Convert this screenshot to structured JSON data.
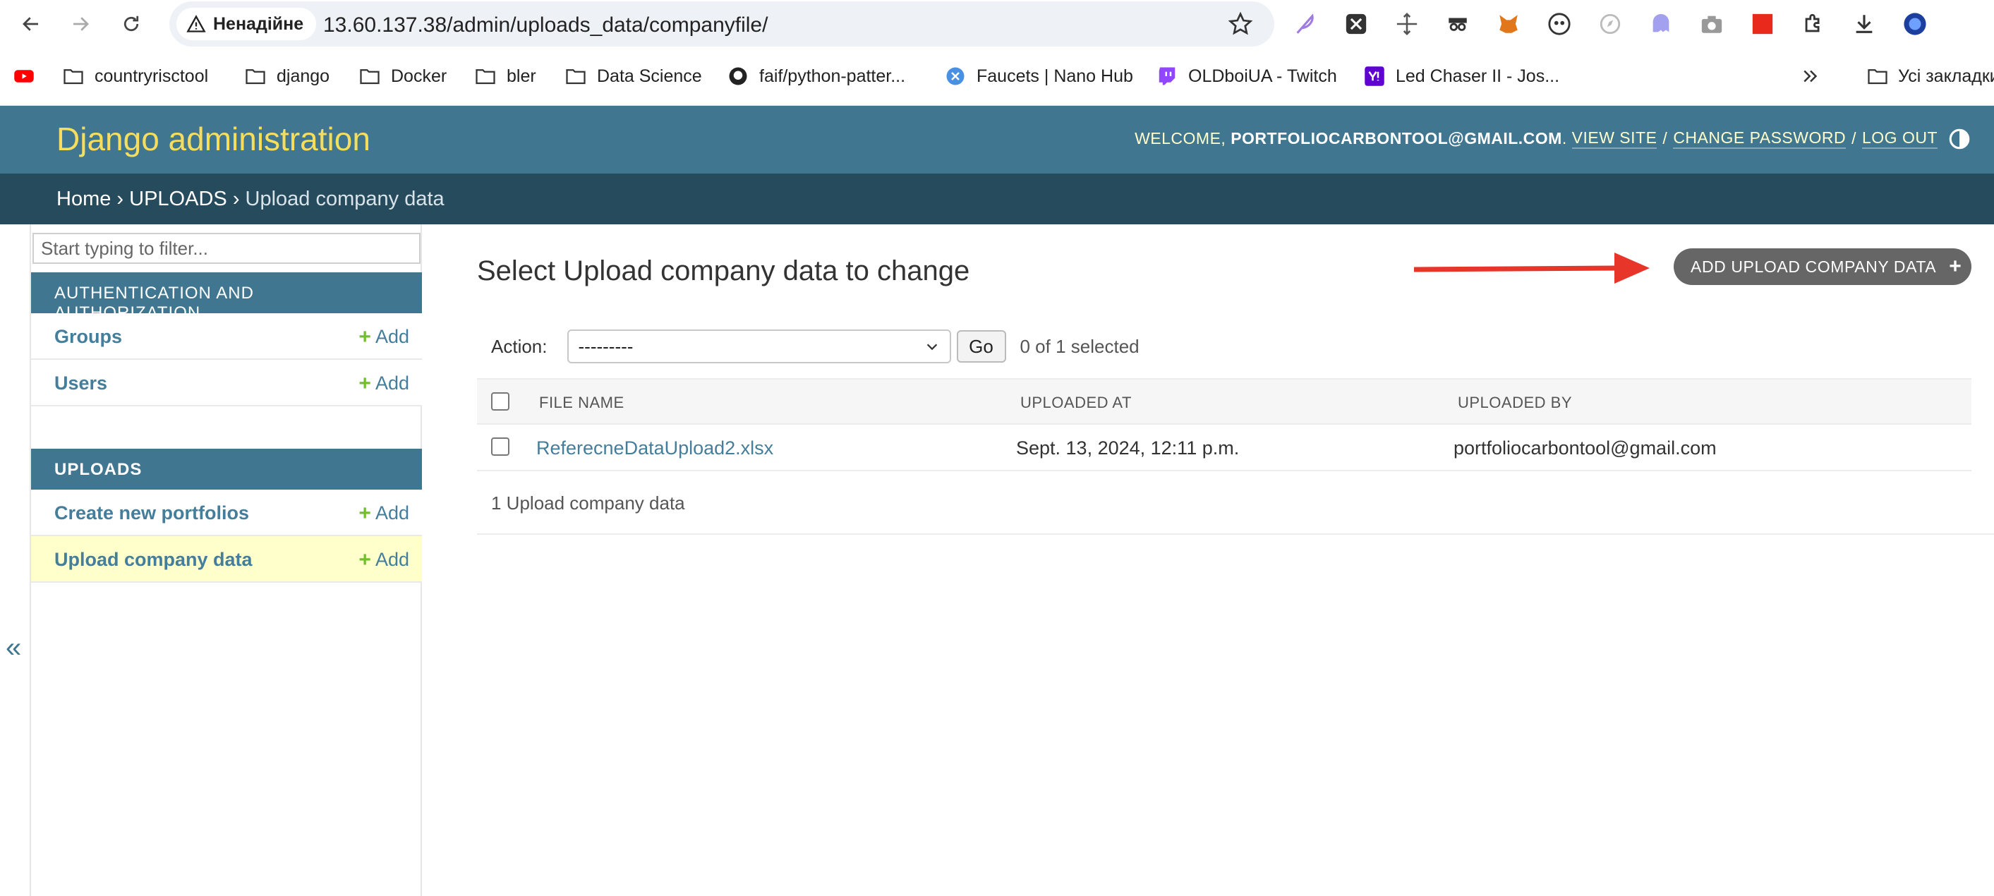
{
  "browser": {
    "security_label": "Ненадійне",
    "url": "13.60.137.38/admin/uploads_data/companyfile/",
    "bookmarks": [
      {
        "label": "countryrisctool",
        "icon": "folder-icon"
      },
      {
        "label": "django",
        "icon": "folder-icon"
      },
      {
        "label": "Docker",
        "icon": "folder-icon"
      },
      {
        "label": "bler",
        "icon": "folder-icon"
      },
      {
        "label": "Data Science",
        "icon": "folder-icon"
      },
      {
        "label": "faif/python-patter...",
        "icon": "github-icon"
      },
      {
        "label": "Faucets | Nano Hub",
        "icon": "nano-icon"
      },
      {
        "label": "OLDboiUA - Twitch",
        "icon": "twitch-icon"
      },
      {
        "label": "Led Chaser II - Jos...",
        "icon": "yahoo-icon"
      }
    ],
    "all_bookmarks_label": "Усі закладки",
    "colors": {
      "accent": "#417690",
      "header_text": "#f5dd5d",
      "breadcrumbs_bg": "#264b5d"
    }
  },
  "header": {
    "branding": "Django administration",
    "welcome": "WELCOME,",
    "user": "PORTFOLIOCARBONTOOL@GMAIL.COM",
    "view_site": "VIEW SITE",
    "change_password": "CHANGE PASSWORD",
    "log_out": "LOG OUT"
  },
  "breadcrumbs": {
    "home": "Home",
    "app": "UPLOADS",
    "current": "Upload company data"
  },
  "sidebar": {
    "filter_placeholder": "Start typing to filter...",
    "collapse": "«",
    "add_label": "Add",
    "auth": {
      "caption": "AUTHENTICATION AND AUTHORIZATION",
      "items": [
        {
          "label": "Groups"
        },
        {
          "label": "Users"
        }
      ]
    },
    "uploads": {
      "caption": "UPLOADS",
      "items": [
        {
          "label": "Create new portfolios"
        },
        {
          "label": "Upload company data"
        }
      ]
    }
  },
  "content": {
    "title": "Select Upload company data to change",
    "add_button": "ADD UPLOAD COMPANY DATA",
    "action_label": "Action:",
    "action_value": "---------",
    "go": "Go",
    "selected": "0 of 1 selected",
    "columns": [
      "FILE NAME",
      "UPLOADED AT",
      "UPLOADED BY"
    ],
    "rows": [
      {
        "file_name": "ReferecneDataUpload2.xlsx",
        "uploaded_at": "Sept. 13, 2024, 12:11 p.m.",
        "uploaded_by": "portfoliocarbontool@gmail.com"
      }
    ],
    "paginator": "1 Upload company data"
  }
}
